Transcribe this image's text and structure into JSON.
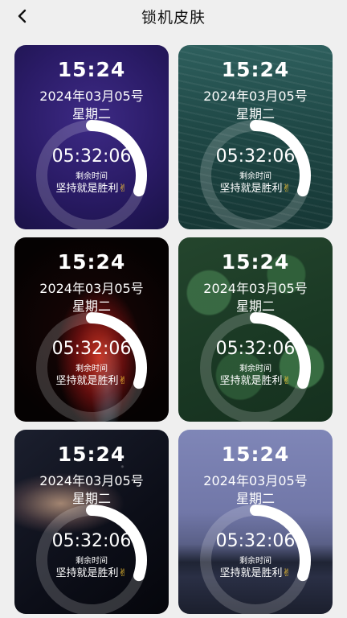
{
  "header": {
    "title": "锁机皮肤",
    "back_icon": "chevron-left-icon"
  },
  "skins": [
    {
      "background": "purple-gradient",
      "time": "15:24",
      "date": "2024年03月05号",
      "weekday": "星期二",
      "countdown": "05:32:06",
      "remaining_label": "剩余时间",
      "motto": "坚持就是胜利",
      "emoji": "✌",
      "progress": 0.3
    },
    {
      "background": "ocean-water",
      "time": "15:24",
      "date": "2024年03月05号",
      "weekday": "星期二",
      "countdown": "05:32:06",
      "remaining_label": "剩余时间",
      "motto": "坚持就是胜利",
      "emoji": "✌",
      "progress": 0.3
    },
    {
      "background": "red-abstract-light",
      "time": "15:24",
      "date": "2024年03月05号",
      "weekday": "星期二",
      "countdown": "05:32:06",
      "remaining_label": "剩余时间",
      "motto": "坚持就是胜利",
      "emoji": "✌",
      "progress": 0.3
    },
    {
      "background": "forest-aerial",
      "time": "15:24",
      "date": "2024年03月05号",
      "weekday": "星期二",
      "countdown": "05:32:06",
      "remaining_label": "剩余时间",
      "motto": "坚持就是胜利",
      "emoji": "✌",
      "progress": 0.3
    },
    {
      "background": "galaxy",
      "time": "15:24",
      "date": "2024年03月05号",
      "weekday": "星期二",
      "countdown": "05:32:06",
      "remaining_label": "剩余时间",
      "motto": "坚持就是胜利",
      "emoji": "✌",
      "progress": 0.3
    },
    {
      "background": "lake-dusk",
      "time": "15:24",
      "date": "2024年03月05号",
      "weekday": "星期二",
      "countdown": "05:32:06",
      "remaining_label": "剩余时间",
      "motto": "坚持就是胜利",
      "emoji": "✌",
      "progress": 0.3
    }
  ],
  "colors": {
    "page_background": "#efefef",
    "title_text": "#111111",
    "overlay_text": "#ffffff",
    "ring_progress": "#ffffff",
    "ring_track": "rgba(255,255,255,0.18)",
    "emoji": "#ffcc33"
  }
}
